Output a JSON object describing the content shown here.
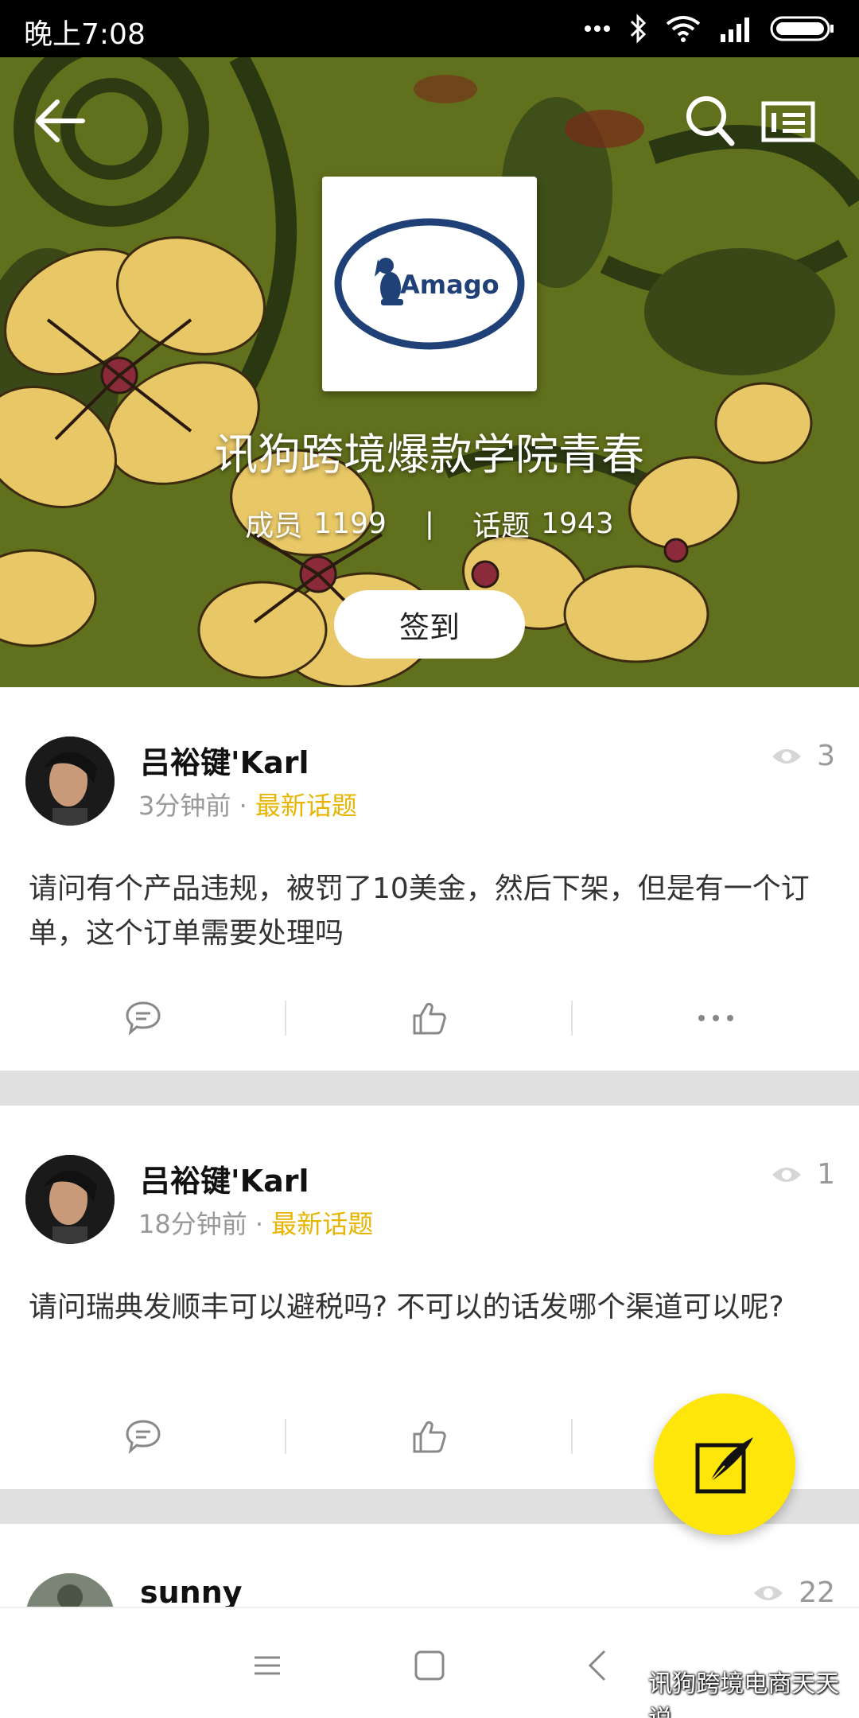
{
  "status_bar": {
    "time": "晚上7:08"
  },
  "header": {
    "logo_text": "Amago",
    "group_name": "讯狗跨境爆款学院青春",
    "members_label": "成员",
    "members_count": "1199",
    "separator": "|",
    "topics_label": "话题",
    "topics_count": "1943",
    "checkin_label": "签到"
  },
  "posts": [
    {
      "author": "吕裕键'Karl",
      "time": "3分钟前",
      "dot": "·",
      "category": "最新话题",
      "views": "3",
      "content": "请问有个产品违规，被罚了10美金，然后下架，但是有一个订单，这个订单需要处理吗"
    },
    {
      "author": "吕裕键'Karl",
      "time": "18分钟前",
      "dot": "·",
      "category": "最新话题",
      "views": "1",
      "content": "请问瑞典发顺丰可以避税吗? 不可以的话发哪个渠道可以呢?"
    },
    {
      "author": "sunny",
      "views": "22"
    }
  ],
  "watermark": {
    "text": "讯狗跨境电商天天说"
  },
  "colors": {
    "accent": "#e7b500",
    "fab": "#fee50a",
    "divider": "#e0e0e0"
  },
  "icons": [
    "back-arrow-icon",
    "search-icon",
    "group-info-icon",
    "eye-icon",
    "comment-icon",
    "like-icon",
    "more-icon",
    "compose-icon",
    "menu-icon",
    "home-icon",
    "back-icon",
    "wechat-icon"
  ]
}
